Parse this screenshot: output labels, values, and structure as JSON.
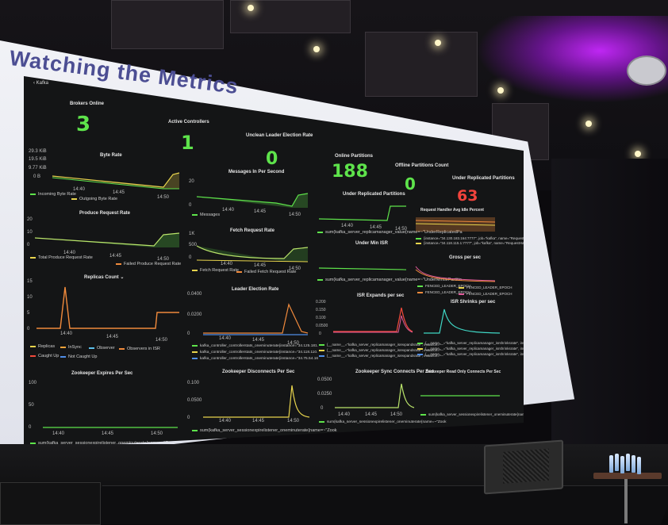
{
  "slide": {
    "title": "Watching the Metrics"
  },
  "dashboard": {
    "app_breadcrumb": "Kafka",
    "stats": [
      {
        "title": "Brokers Online",
        "value": "3",
        "color": "#5ee34b"
      },
      {
        "title": "Active Controllers",
        "value": "1",
        "color": "#5ee34b"
      },
      {
        "title": "Unclean Leader Election Rate",
        "value": "0",
        "color": "#5ee34b"
      },
      {
        "title": "Online Partitions",
        "value": "188",
        "color": "#5ee34b"
      },
      {
        "title": "Offline Partitions Count",
        "value": "0",
        "color": "#5ee34b"
      },
      {
        "title": "Under Replicated Partitions",
        "value": "63",
        "color": "#f1433c"
      }
    ],
    "byte_rate": {
      "title": "Byte Rate",
      "yticks": [
        "29.3 KiB",
        "19.5 KiB",
        "9.77 KiB",
        "0 B"
      ],
      "xticks": [
        "14:40",
        "14:45",
        "14:50"
      ],
      "legend": [
        "Incoming Byte Rate",
        "Outgoing Byte Rate"
      ]
    },
    "messages_in": {
      "title": "Messages In Per Second",
      "yticks": [
        "20",
        "0"
      ],
      "xticks": [
        "14:40",
        "14:45",
        "14:50"
      ],
      "legend": [
        "Messages"
      ]
    },
    "under_replicated": {
      "title": "Under Replicated Partitions",
      "xticks": [
        "14:40",
        "14:45",
        "14:50"
      ],
      "legend": [
        "sum(kafka_server_replicamanager_value{name=~\"UnderReplicatedPa"
      ]
    },
    "request_handler": {
      "title": "Request Handler Avg Idle Percent",
      "legend": [
        "{instance=\"34.130.183.164:7777\", job=\"kafka\", name=\"RequestHandlerAvg",
        "{instance=\"34.118.115.1:7777\", job=\"kafka\", name=\"RequestHandlerAvg"
      ]
    },
    "produce_request": {
      "title": "Produce Request Rate",
      "yticks": [
        "20",
        "10",
        "0"
      ],
      "xticks": [
        "14:40",
        "14:45",
        "14:50"
      ],
      "legend": [
        "Total Produce Request Rate",
        "Failed Produce Request Rate"
      ]
    },
    "fetch_request": {
      "title": "Fetch Request Rate",
      "yticks": [
        "1K",
        "500",
        "0"
      ],
      "xticks": [
        "14:40",
        "14:45",
        "14:50"
      ],
      "legend": [
        "Fetch Request Rate",
        "Failed Fetch Request Rate"
      ]
    },
    "under_min_isr": {
      "title": "Under Min ISR",
      "legend": [
        "sum(kafka_server_replicamanager_value{name=~\"UnderMinIsrPartitio"
      ]
    },
    "gross_per_sec": {
      "title": "Gross per sec",
      "legend": [
        "FENCED_LEADER_EPOCH",
        "FENCED_LEADER_EPOCH",
        "FENCED_LEADER_EPOCH",
        "FENCED_LEADER_EPOCH"
      ]
    },
    "replicas_count": {
      "title": "Replicas Count",
      "yticks": [
        "15",
        "10",
        "5",
        "0"
      ],
      "xticks": [
        "14:40",
        "14:45",
        "14:50"
      ],
      "legend": [
        "Replicas",
        "InSync",
        "Observer",
        "Observers in ISR",
        "Caught Up",
        "Not Caught Up"
      ],
      "legend_colors": [
        "#e8d44d",
        "#f2a33a",
        "#5bc0eb",
        "#f08a3c",
        "#f2493b",
        "#4f8de6"
      ]
    },
    "leader_election": {
      "title": "Leader Election Rate",
      "yticks": [
        "0.0400",
        "0.0200",
        "0"
      ],
      "xticks": [
        "14:40",
        "14:45",
        "14:50"
      ],
      "legend": [
        "kafka_controller_controllerstats_oneminuterate{instance=\"34.125.181.",
        "kafka_controller_controllerstats_oneminuterate{instance=\"34.118.110.",
        "kafka_controller_controllerstats_oneminuterate{instance=\"34.75.54.16"
      ]
    },
    "isr_expands": {
      "title": "ISR Expands per sec",
      "yticks": [
        "0.200",
        "0.150",
        "0.100",
        "0.0500",
        "0"
      ],
      "legend": [
        "{__name__=\"kafka_server_replicamanager_isrexpandsrate\", instance=\"",
        "{__name__=\"kafka_server_replicamanager_isrexpandsrate\", instance=\"",
        "{__name__=\"kafka_server_replicamanager_isrexpandsrate\", instance=\""
      ]
    },
    "isr_shrinks": {
      "title": "ISR Shrinks per sec",
      "legend": [
        "{__name__=\"kafka_server_replicamanager_isrshrinksrate\", instance=\"",
        "{__name__=\"kafka_server_replicamanager_isrshrinksrate\", instance=\"",
        "{__name__=\"kafka_server_replicamanager_isrshrinksrate\", instance=\""
      ]
    },
    "zk_expires": {
      "title": "Zookeeper Expires Per Sec",
      "yticks": [
        "100",
        "50",
        "0"
      ],
      "xticks": [
        "14:40",
        "14:45",
        "14:50"
      ],
      "legend": [
        "sum(kafka_server_sessionexpirelistener_oneminuterate{name=~\"Zook"
      ]
    },
    "zk_disconnects": {
      "title": "Zookeeper Disconnects Per Sec",
      "yticks": [
        "0.100",
        "0.0500",
        "0"
      ],
      "xticks": [
        "14:40",
        "14:45",
        "14:50"
      ],
      "legend": [
        "sum(kafka_server_sessionexpirelistener_oneminuterate{name=~\"Zook"
      ]
    },
    "zk_sync": {
      "title": "Zookeeper Sync Connects Per Sec",
      "yticks": [
        "0.0500",
        "0.0250",
        "0"
      ],
      "xticks": [
        "14:40",
        "14:45",
        "14:50"
      ],
      "legend": [
        "sum(kafka_server_sessionexpirelistener_oneminuterate{name=~\"Zook"
      ]
    },
    "zk_readonly": {
      "title": "Zookeeper Read Only Connects Per Sec",
      "legend": [
        "sum(kafka_server_sessionexpirelistener_oneminuterate{name=~\"Zook"
      ]
    },
    "colors": {
      "green": "#5ee34b",
      "yellow": "#e8d44d",
      "orange": "#f08a3c",
      "red": "#f1433c",
      "blue": "#4f8de6",
      "cyan": "#3fd6c4",
      "pink": "#e25b9b"
    }
  }
}
